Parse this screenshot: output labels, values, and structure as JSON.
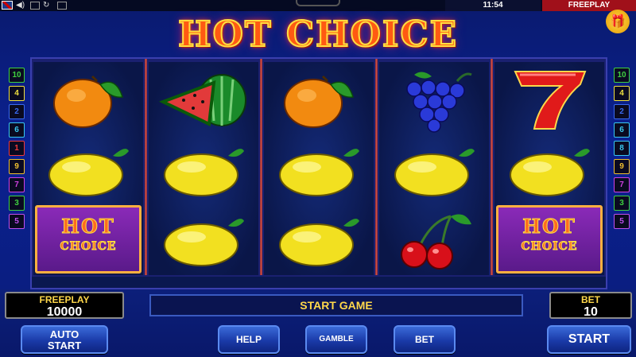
{
  "topbar": {
    "clock": "11:54",
    "freeplay_tag": "FREEPLAY"
  },
  "title": "HOT CHOICE",
  "lines_left": [
    {
      "n": "10",
      "color": "#3fd13f"
    },
    {
      "n": "4",
      "color": "#f0e040"
    },
    {
      "n": "2",
      "color": "#3a6af0"
    },
    {
      "n": "6",
      "color": "#3ac8f0"
    },
    {
      "n": "1",
      "color": "#f03a3a"
    },
    {
      "n": "9",
      "color": "#f0c030"
    },
    {
      "n": "7",
      "color": "#d040e0"
    },
    {
      "n": "3",
      "color": "#3fd13f"
    },
    {
      "n": "5",
      "color": "#c050f0"
    }
  ],
  "lines_right": [
    {
      "n": "10",
      "color": "#3fd13f"
    },
    {
      "n": "4",
      "color": "#f0e040"
    },
    {
      "n": "2",
      "color": "#3a6af0"
    },
    {
      "n": "6",
      "color": "#3ac8f0"
    },
    {
      "n": "8",
      "color": "#3ac8f0"
    },
    {
      "n": "9",
      "color": "#f0c030"
    },
    {
      "n": "7",
      "color": "#d040e0"
    },
    {
      "n": "3",
      "color": "#3fd13f"
    },
    {
      "n": "5",
      "color": "#c050f0"
    }
  ],
  "reels": [
    [
      "orange",
      "lemon",
      "hot-choice"
    ],
    [
      "watermelon",
      "lemon",
      "lemon"
    ],
    [
      "orange",
      "lemon",
      "lemon"
    ],
    [
      "grapes",
      "lemon",
      "cherries"
    ],
    [
      "seven",
      "lemon",
      "hot-choice"
    ]
  ],
  "hot_choice_symbol": {
    "line1": "HOT",
    "line2": "CHOICE"
  },
  "freeplay": {
    "label": "FREEPLAY",
    "value": "10000"
  },
  "bet": {
    "label": "BET",
    "value": "10"
  },
  "message": "START GAME",
  "buttons": {
    "auto_start_line1": "AUTO",
    "auto_start_line2": "START",
    "help": "HELP",
    "gamble": "GAMBLE",
    "bet": "BET",
    "start": "START"
  }
}
